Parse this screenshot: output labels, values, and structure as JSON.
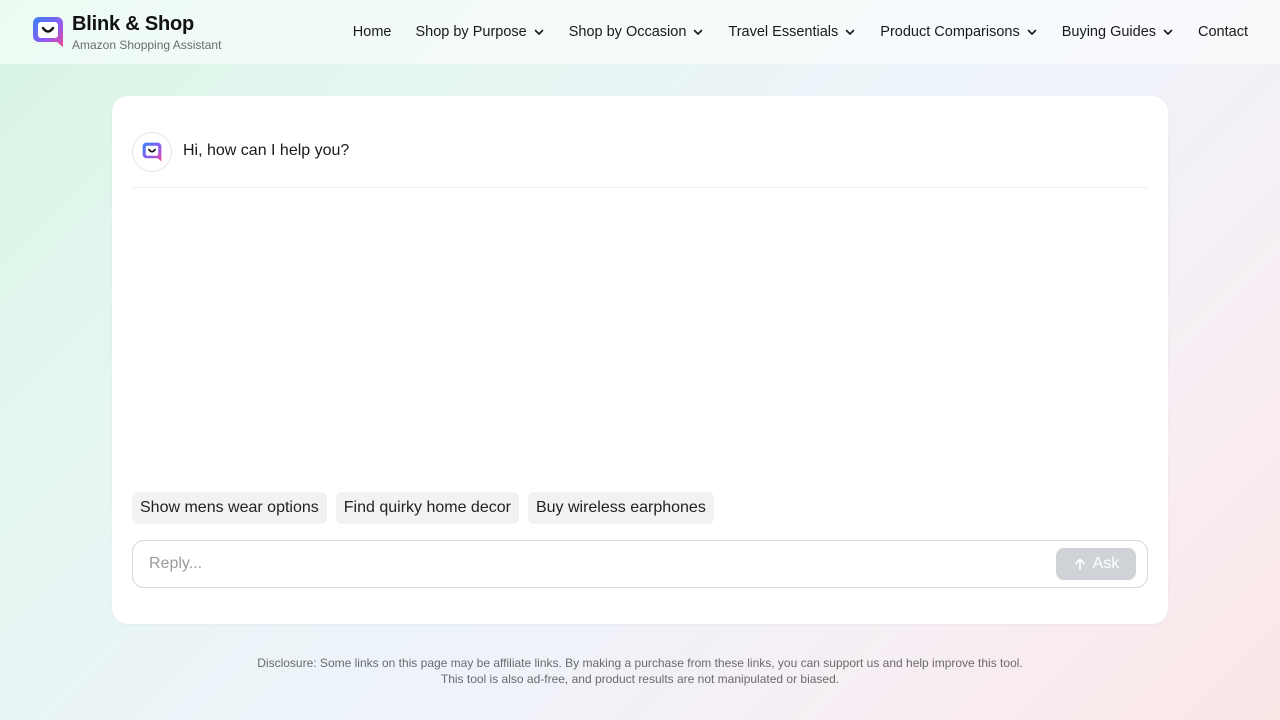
{
  "brand": {
    "name": "Blink & Shop",
    "subtitle": "Amazon Shopping Assistant",
    "logo_icon": "chat-smile-logo-icon",
    "accent_gradient": [
      "#3b82f6",
      "#8b5cf6",
      "#ec4899"
    ]
  },
  "nav": {
    "items": [
      {
        "label": "Home",
        "has_dropdown": false
      },
      {
        "label": "Shop by Purpose",
        "has_dropdown": true
      },
      {
        "label": "Shop by Occasion",
        "has_dropdown": true
      },
      {
        "label": "Travel Essentials",
        "has_dropdown": true
      },
      {
        "label": "Product Comparisons",
        "has_dropdown": true
      },
      {
        "label": "Buying Guides",
        "has_dropdown": true
      },
      {
        "label": "Contact",
        "has_dropdown": false
      }
    ]
  },
  "chat": {
    "greeting": "Hi, how can I help you?",
    "suggestions": [
      "Show mens wear options",
      "Find quirky home decor",
      "Buy wireless earphones"
    ],
    "reply": {
      "placeholder": "Reply...",
      "value": "",
      "ask_label": "Ask",
      "ask_icon": "arrow-up-icon",
      "ask_button_color": "#cfd2d6"
    }
  },
  "footer": {
    "disclosure": "Disclosure: Some links on this page may be affiliate links. By making a purchase from these links, you can support us and help improve this tool. This tool is also ad-free, and product results are not manipulated or biased."
  }
}
